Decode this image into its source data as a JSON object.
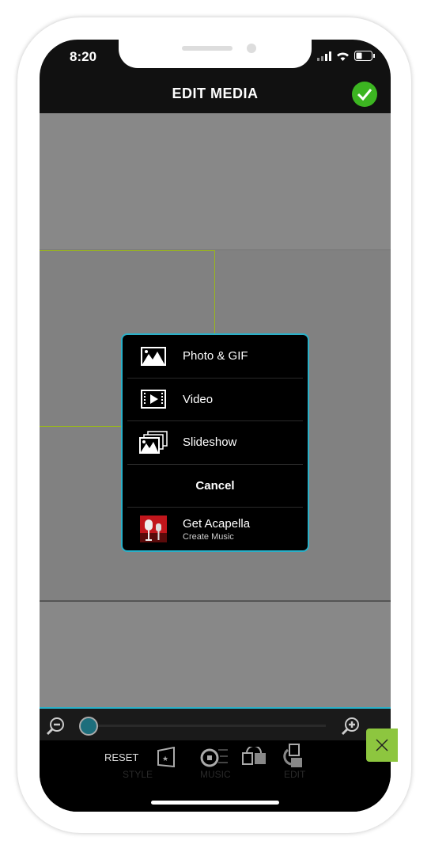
{
  "status_bar": {
    "time": "8:20",
    "icons": [
      "signal-icon",
      "wifi-icon",
      "battery-icon"
    ]
  },
  "header": {
    "title": "EDIT MEDIA",
    "confirm_icon": "check-icon",
    "confirm_color": "#3cb521"
  },
  "menu": {
    "items": [
      {
        "label": "Photo & GIF",
        "icon": "photo-icon"
      },
      {
        "label": "Video",
        "icon": "video-icon"
      },
      {
        "label": "Slideshow",
        "icon": "slideshow-icon"
      }
    ],
    "cancel": "Cancel",
    "promo": {
      "title": "Get Acapella",
      "subtitle": "Create Music",
      "icon": "acapella-app-icon"
    },
    "border_color": "#2ab0c8"
  },
  "zoom_bar": {
    "zoom_out_icon": "zoom-out-icon",
    "zoom_in_icon": "zoom-in-icon",
    "slider_value": 0
  },
  "toolbar": {
    "reset": "RESET",
    "style": "STYLE",
    "music": "MUSIC",
    "edit": "EDIT"
  },
  "close_color": "#8dc63f"
}
